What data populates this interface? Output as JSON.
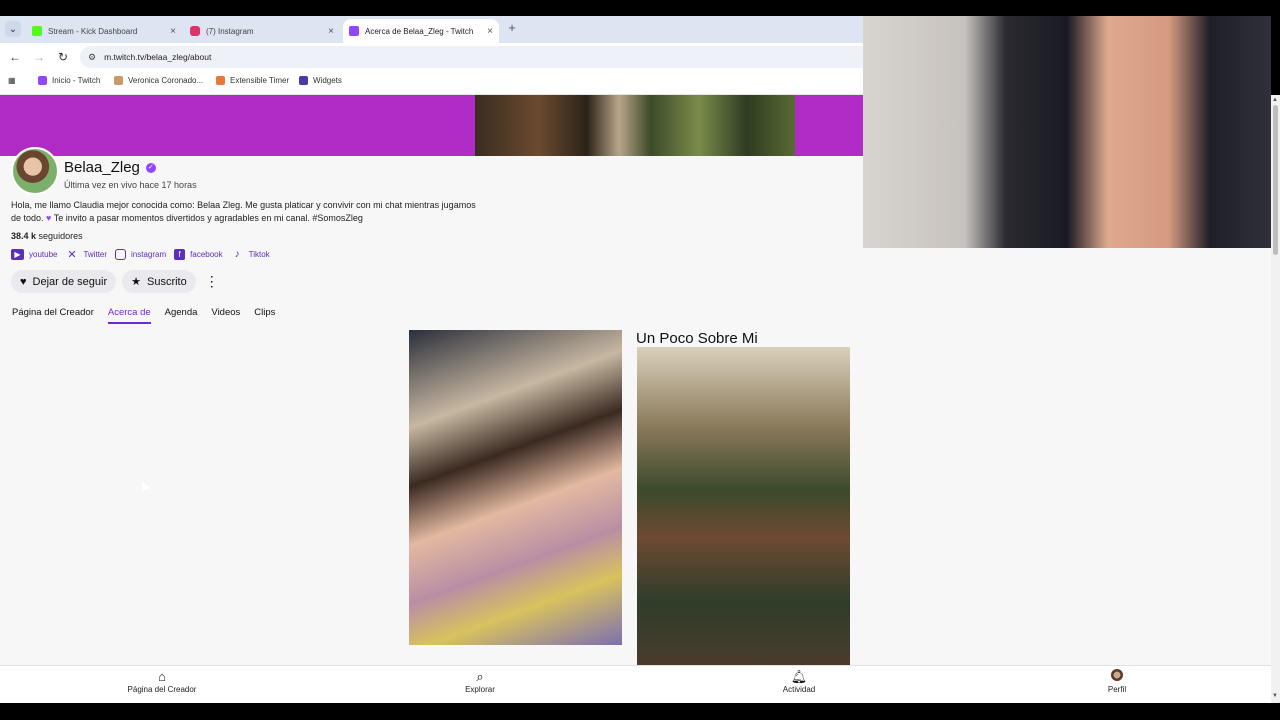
{
  "browser": {
    "tabs": [
      {
        "title": "Stream - Kick Dashboard",
        "favicon": "kick-icon",
        "color": "#53fc18"
      },
      {
        "title": "(7) Instagram",
        "favicon": "instagram-icon",
        "color": "#e1306c"
      },
      {
        "title": "Acerca de Belaa_Zleg - Twitch",
        "favicon": "twitch-icon",
        "color": "#9147ff",
        "active": true
      }
    ],
    "new_tab_label": "+",
    "url": "m.twitch.tv/belaa_zleg/about",
    "bookmarks": [
      {
        "label": "Inicio - Twitch",
        "icon": "twitch-icon"
      },
      {
        "label": "Veronica Coronado...",
        "icon": "page-icon"
      },
      {
        "label": "Extensible Timer",
        "icon": "timer-icon"
      },
      {
        "label": "Widgets",
        "icon": "widgets-icon"
      }
    ]
  },
  "channel": {
    "name": "Belaa_Zleg",
    "last_live": "Última vez en vivo hace 17 horas",
    "bio_line1": "Hola, me llamo Claudia mejor conocida como: Belaa Zleg. Me gusta platicar y convivir con mi chat mientras jugamos",
    "bio_line2_prefix": "de todo.",
    "bio_line2_suffix": "Te invito a pasar momentos divertidos y agradables en mi canal. #SomosZleg",
    "followers_count": "38.4 k",
    "followers_label": "seguidores",
    "socials": [
      {
        "label": "youtube",
        "icon": "youtube-icon"
      },
      {
        "label": "Twitter",
        "icon": "x-twitter-icon"
      },
      {
        "label": "instagram",
        "icon": "instagram-icon"
      },
      {
        "label": "facebook",
        "icon": "facebook-icon"
      },
      {
        "label": "Tiktok",
        "icon": "tiktok-icon"
      }
    ],
    "unfollow_label": "Dejar de seguir",
    "subscribed_label": "Suscrito",
    "accent_color": "#9147ff",
    "banner_color": "#b12bc6"
  },
  "subnav": {
    "tabs": [
      {
        "label": "Página del Creador"
      },
      {
        "label": "Acerca de",
        "active": true
      },
      {
        "label": "Agenda"
      },
      {
        "label": "Videos"
      },
      {
        "label": "Clips"
      }
    ]
  },
  "panels": {
    "title": "Un Poco Sobre Mi"
  },
  "bottom_nav": {
    "items": [
      {
        "label": "Página del Creador",
        "icon": "home-icon"
      },
      {
        "label": "Explorar",
        "icon": "search-icon"
      },
      {
        "label": "Actividad",
        "icon": "bell-icon"
      },
      {
        "label": "Perfil",
        "icon": "avatar-icon"
      }
    ]
  }
}
